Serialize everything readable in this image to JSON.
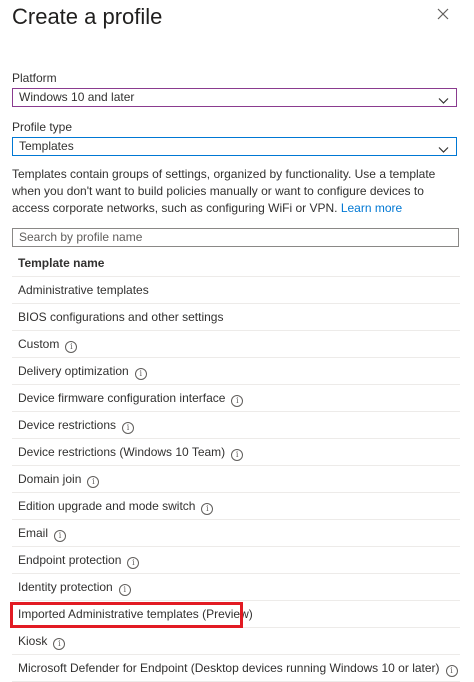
{
  "header": {
    "title": "Create a profile",
    "close_icon": "close-icon"
  },
  "platform": {
    "label": "Platform",
    "value": "Windows 10 and later"
  },
  "profile_type": {
    "label": "Profile type",
    "value": "Templates"
  },
  "description": {
    "text": "Templates contain groups of settings, organized by functionality. Use a template when you don't want to build policies manually or want to configure devices to access corporate networks, such as configuring WiFi or VPN.",
    "link": "Learn more"
  },
  "search": {
    "placeholder": "Search by profile name"
  },
  "table": {
    "header": "Template name",
    "rows": [
      {
        "name": "Administrative templates",
        "info": false
      },
      {
        "name": "BIOS configurations and other settings",
        "info": false
      },
      {
        "name": "Custom",
        "info": true
      },
      {
        "name": "Delivery optimization",
        "info": true
      },
      {
        "name": "Device firmware configuration interface",
        "info": true
      },
      {
        "name": "Device restrictions",
        "info": true
      },
      {
        "name": "Device restrictions (Windows 10 Team)",
        "info": true
      },
      {
        "name": "Domain join",
        "info": true
      },
      {
        "name": "Edition upgrade and mode switch",
        "info": true
      },
      {
        "name": "Email",
        "info": true
      },
      {
        "name": "Endpoint protection",
        "info": true
      },
      {
        "name": "Identity protection",
        "info": true
      },
      {
        "name": "Imported Administrative templates (Preview)",
        "info": false
      },
      {
        "name": "Kiosk",
        "info": true
      },
      {
        "name": "Microsoft Defender for Endpoint (Desktop devices running Windows 10 or later)",
        "info": true
      }
    ]
  },
  "colors": {
    "accent": "#0078d4",
    "highlight": "#e21b23",
    "platform_border": "#8a3b8f"
  }
}
